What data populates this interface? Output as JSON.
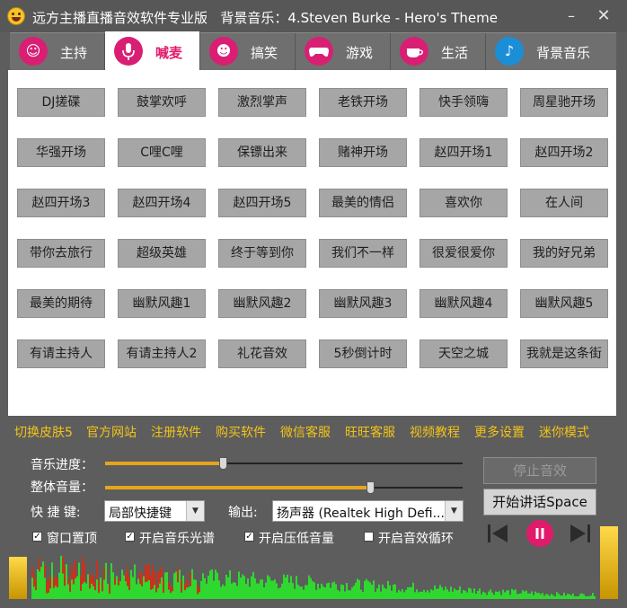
{
  "app": {
    "title": "远方主播直播音效软件专业版",
    "bgm_prefix": "背景音乐：",
    "bgm_track": "4.Steven Burke - Hero's Theme"
  },
  "tabs": [
    {
      "label": "主持",
      "icon": "host-face-icon",
      "active": false
    },
    {
      "label": "喊麦",
      "icon": "microphone-icon",
      "active": true
    },
    {
      "label": "搞笑",
      "icon": "laughing-face-icon",
      "active": false
    },
    {
      "label": "游戏",
      "icon": "gamepad-icon",
      "active": false
    },
    {
      "label": "生活",
      "icon": "teacup-icon",
      "active": false
    },
    {
      "label": "背景音乐",
      "icon": "music-note-icon",
      "active": false
    }
  ],
  "sfx_buttons": [
    [
      "DJ搓碟",
      "鼓掌欢呼",
      "激烈掌声",
      "老铁开场",
      "快手领嗨",
      "周星驰开场"
    ],
    [
      "华强开场",
      "C哩C哩",
      "保镖出来",
      "赌神开场",
      "赵四开场1",
      "赵四开场2"
    ],
    [
      "赵四开场3",
      "赵四开场4",
      "赵四开场5",
      "最美的情侣",
      "喜欢你",
      "在人间"
    ],
    [
      "带你去旅行",
      "超级英雄",
      "终于等到你",
      "我们不一样",
      "很爱很爱你",
      "我的好兄弟"
    ],
    [
      "最美的期待",
      "幽默风趣1",
      "幽默风趣2",
      "幽默风趣3",
      "幽默风趣4",
      "幽默风趣5"
    ],
    [
      "有请主持人",
      "有请主持人2",
      "礼花音效",
      "5秒倒计时",
      "天空之城",
      "我就是这条街"
    ]
  ],
  "links": [
    "切换皮肤5",
    "官方网站",
    "注册软件",
    "购买软件",
    "微信客服",
    "旺旺客服",
    "视频教程",
    "更多设置",
    "迷你模式"
  ],
  "controls": {
    "music_progress_label": "音乐进度：",
    "music_progress_fraction": 0.33,
    "volume_label": "整体音量：",
    "volume_fraction": 0.74,
    "hotkey_label": "快 捷 键:",
    "hotkey_value": "局部快捷键",
    "output_label": "输出:",
    "output_value": "扬声器 (Realtek High Defi...",
    "stop_button": "停止音效",
    "talk_button": "开始讲话Space",
    "checkboxes": [
      {
        "label": "窗口置顶",
        "checked": true
      },
      {
        "label": "开启音乐光谱",
        "checked": true
      },
      {
        "label": "开启压低音量",
        "checked": true
      },
      {
        "label": "开启音效循环",
        "checked": false
      }
    ]
  },
  "colors": {
    "accent_pink": "#e11b6c",
    "link_yellow": "#f2c318",
    "slider_fill": "#e6a51c",
    "spectrum_green": "#2fd82f",
    "spectrum_red": "#c8321e"
  }
}
